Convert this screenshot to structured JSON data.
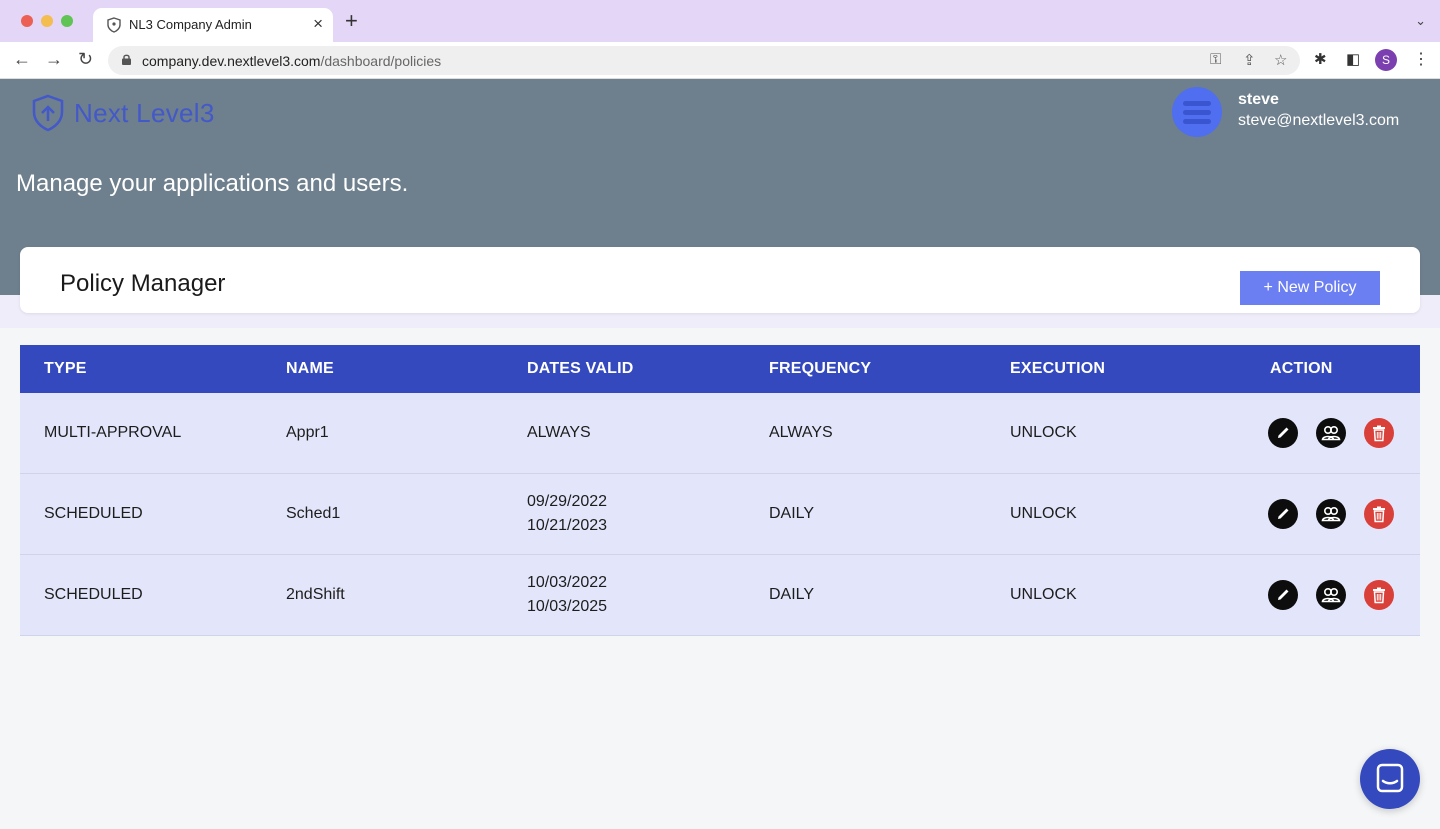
{
  "browser": {
    "tab_title": "NL3 Company Admin",
    "close_glyph": "×",
    "new_tab_glyph": "+",
    "tab_menu_glyph": "⌄",
    "url_domain": "company.dev.nextlevel3.com",
    "url_path": "/dashboard/policies",
    "profile_initial": "S",
    "back_glyph": "←",
    "forward_glyph": "→",
    "reload_glyph": "↻",
    "key_glyph": "⚿",
    "share_glyph": "⇪",
    "star_glyph": "☆",
    "extensions_glyph": "✱",
    "sidepanel_glyph": "◧",
    "menu_glyph": "⋮"
  },
  "header": {
    "logo_text": "Next Level3",
    "user_name": "steve",
    "user_email": "steve@nextlevel3.com",
    "tagline": "Manage your applications and users."
  },
  "policy_manager": {
    "title": "Policy Manager",
    "new_policy_label": "+ New Policy"
  },
  "table": {
    "headers": [
      "TYPE",
      "NAME",
      "DATES VALID",
      "FREQUENCY",
      "EXECUTION",
      "ACTION"
    ],
    "rows": [
      {
        "type": "MULTI-APPROVAL",
        "name": "Appr1",
        "dates": [
          "ALWAYS"
        ],
        "frequency": "ALWAYS",
        "execution": "UNLOCK"
      },
      {
        "type": "SCHEDULED",
        "name": "Sched1",
        "dates": [
          "09/29/2022",
          "10/21/2023"
        ],
        "frequency": "DAILY",
        "execution": "UNLOCK"
      },
      {
        "type": "SCHEDULED",
        "name": "2ndShift",
        "dates": [
          "10/03/2022",
          "10/03/2025"
        ],
        "frequency": "DAILY",
        "execution": "UNLOCK"
      }
    ],
    "action_icons": [
      "edit-icon",
      "users-icon",
      "trash-icon"
    ]
  },
  "colors": {
    "hero": "#6e7f8d",
    "table_header": "#3349bd",
    "row_bg": "#e3e6fb",
    "button": "#6c7ff2",
    "delete": "#d9403a"
  }
}
